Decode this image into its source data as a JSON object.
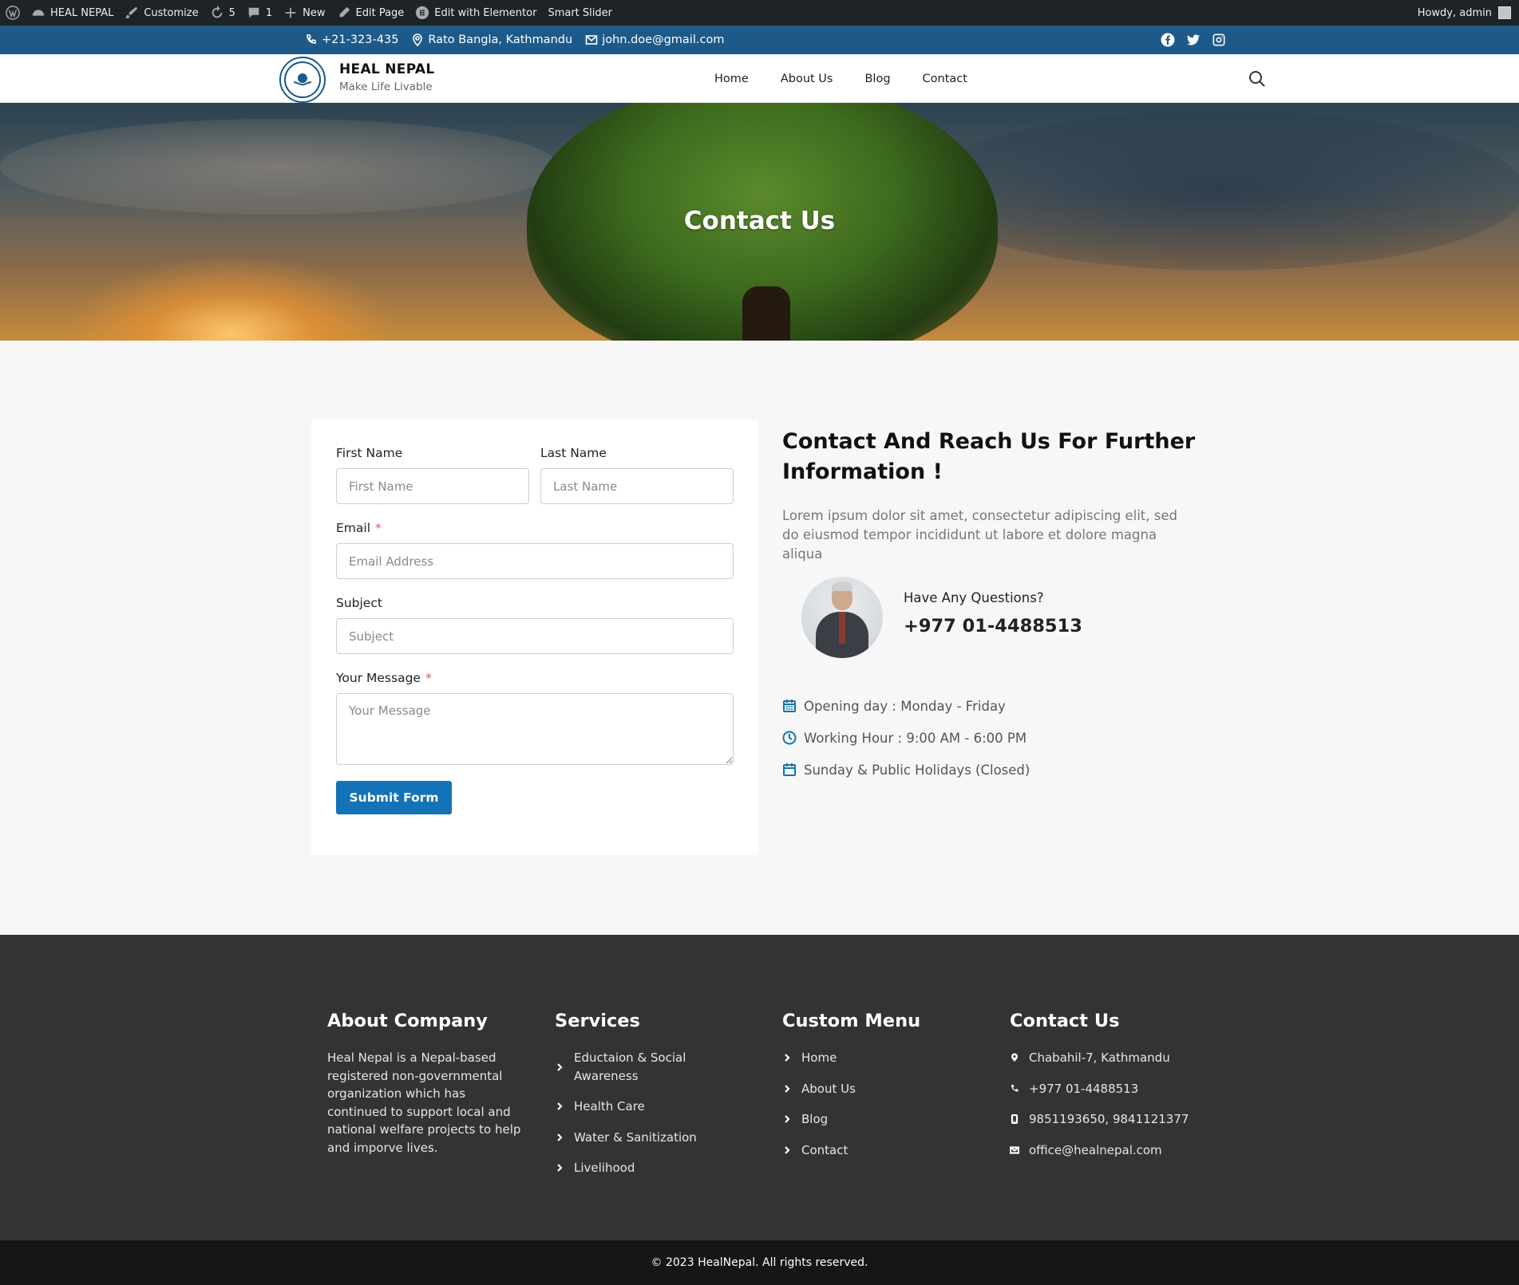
{
  "admin_bar": {
    "site_name": "HEAL NEPAL",
    "customize": "Customize",
    "updates_count": "5",
    "comments_count": "1",
    "new_label": "New",
    "edit_page": "Edit Page",
    "edit_elementor": "Edit with Elementor",
    "smart_slider": "Smart Slider",
    "howdy": "Howdy, admin"
  },
  "topbar": {
    "phone": "+21-323-435",
    "address": "Rato Bangla, Kathmandu",
    "email": "john.doe@gmail.com",
    "social": [
      "facebook-icon",
      "twitter-icon",
      "instagram-icon"
    ]
  },
  "header": {
    "brand_name": "HEAL NEPAL",
    "tagline": "Make Life Livable",
    "nav": [
      "Home",
      "About Us",
      "Blog",
      "Contact"
    ]
  },
  "hero": {
    "title": "Contact Us"
  },
  "form": {
    "first_name_label": "First Name",
    "first_name_placeholder": "First Name",
    "last_name_label": "Last Name",
    "last_name_placeholder": "Last Name",
    "email_label": "Email",
    "email_required": "*",
    "email_placeholder": "Email Address",
    "subject_label": "Subject",
    "subject_placeholder": "Subject",
    "message_label": "Your Message",
    "message_required": "*",
    "message_placeholder": "Your Message",
    "submit_label": "Submit Form"
  },
  "info": {
    "heading": "Contact And Reach Us For Further Information !",
    "lead": "Lorem ipsum dolor sit amet, consectetur adipiscing elit, sed do eiusmod tempor incididunt ut labore et dolore magna aliqua",
    "question_label": "Have Any Questions?",
    "question_phone": "+977 01-4488513",
    "hours": [
      "Opening day : Monday - Friday",
      "Working Hour : 9:00 AM - 6:00 PM",
      "Sunday & Public Holidays (Closed)"
    ]
  },
  "footer": {
    "about_title": "About Company",
    "about_text": "Heal Nepal is a Nepal-based registered non-governmental organization which has continued to support local and national welfare projects to help and imporve lives.",
    "services_title": "Services",
    "services": [
      "Eductaion & Social Awareness",
      "Health Care",
      "Water & Sanitization",
      "Livelihood"
    ],
    "menu_title": "Custom Menu",
    "menu": [
      "Home",
      "About Us",
      "Blog",
      "Contact"
    ],
    "contact_title": "Contact Us",
    "contact": {
      "address": "Chabahil-7, Kathmandu",
      "phone": "+977 01-4488513",
      "mobile": "9851193650, 9841121377",
      "email": "office@healnepal.com"
    },
    "copyright": "© 2023 HealNepal. All rights reserved."
  },
  "colors": {
    "admin_bar": "#1d2327",
    "topbar": "#1d5a8a",
    "accent": "#1373b6",
    "footer": "#333333",
    "copyright_bar": "#161616"
  }
}
